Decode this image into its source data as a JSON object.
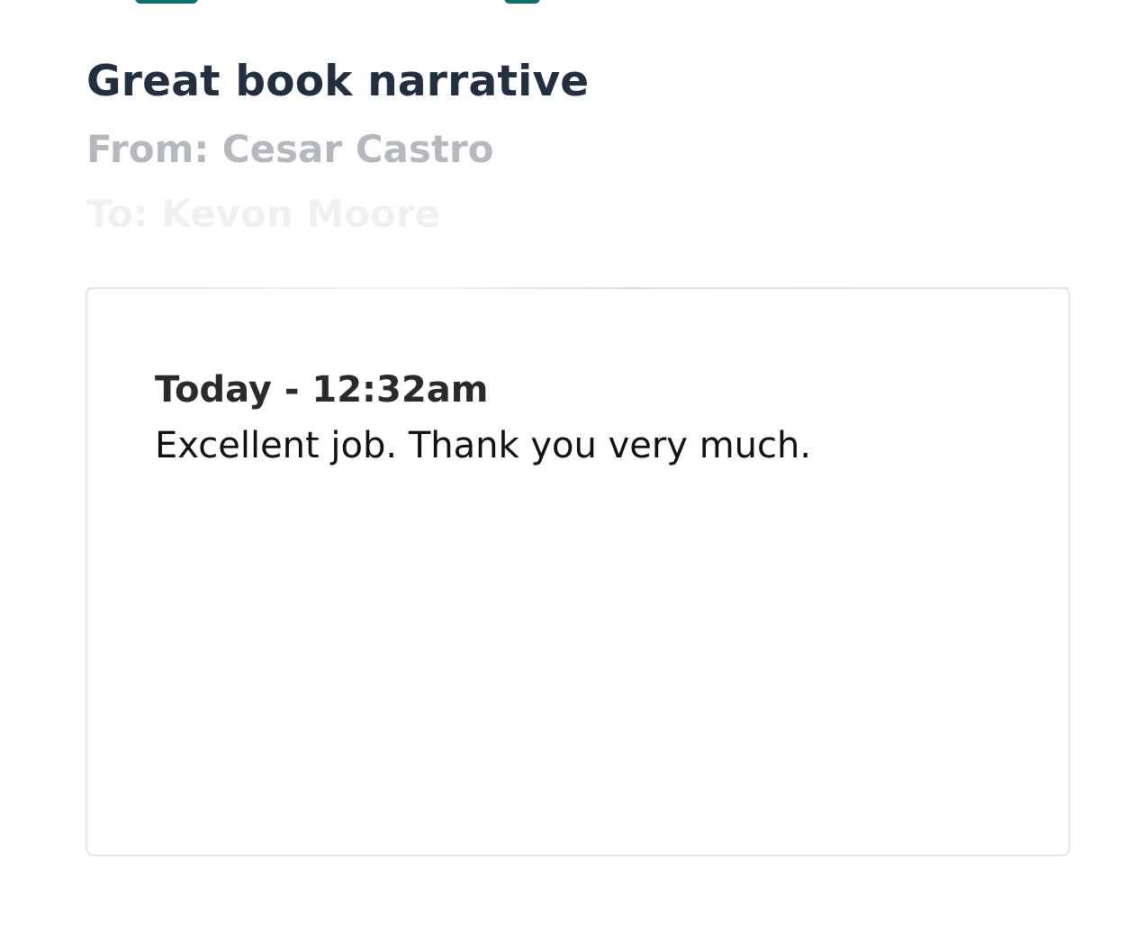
{
  "conversation": {
    "subject": "Great book narrative",
    "from_line": "From: Cesar Castro",
    "to_line": "To: Kevon Moore"
  },
  "messages": [
    {
      "timestamp": "Today - 12:32am",
      "text": "Excellent job. Thank you very much."
    }
  ],
  "colors": {
    "subject": "#232f3e",
    "from": "#b5b9bd",
    "border": "#e4e6e8",
    "accent": "#0f6e6a"
  }
}
